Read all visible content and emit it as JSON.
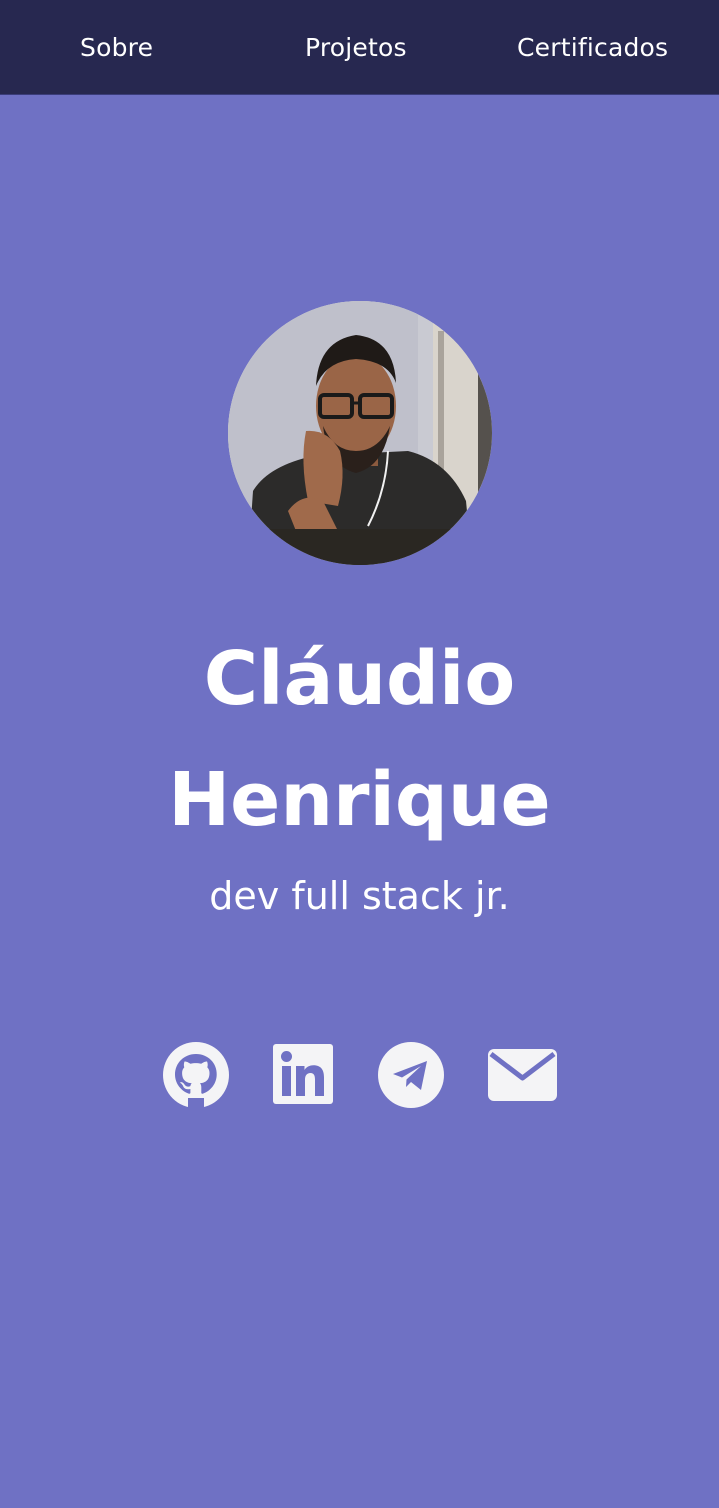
{
  "nav": {
    "items": [
      {
        "label": "Sobre"
      },
      {
        "label": "Projetos"
      },
      {
        "label": "Certificados"
      }
    ]
  },
  "profile": {
    "name_line1": "Cláudio",
    "name_line2": "Henrique",
    "role": "dev full stack jr.",
    "avatar_icon": "profile-photo"
  },
  "social": {
    "icons": [
      "github-icon",
      "linkedin-icon",
      "telegram-icon",
      "email-icon"
    ]
  },
  "colors": {
    "background": "#6f71c4",
    "navbar": "#272850",
    "text": "#ffffff",
    "icon": "#f4f4f6"
  }
}
